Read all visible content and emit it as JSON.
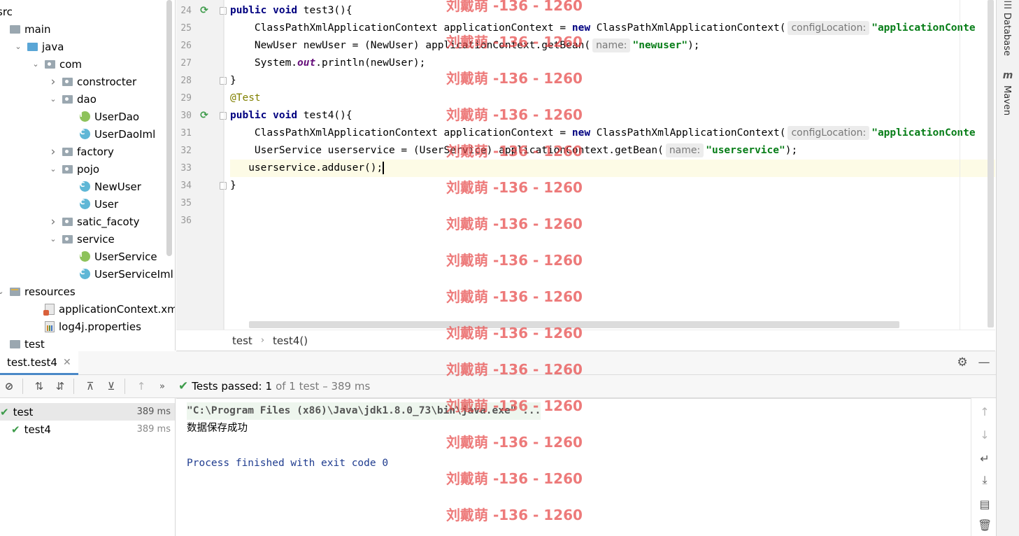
{
  "project_tree": [
    {
      "label": "src",
      "icon": "folder-icon",
      "indent": 0,
      "arrow": ""
    },
    {
      "label": "main",
      "icon": "folder-icon",
      "indent": 0,
      "arrow": ""
    },
    {
      "label": "java",
      "icon": "source-folder-icon",
      "indent": 1,
      "arrow": "down"
    },
    {
      "label": "com",
      "icon": "package-icon",
      "indent": 2,
      "arrow": "down"
    },
    {
      "label": "constrocter",
      "icon": "package-icon",
      "indent": 3,
      "arrow": "right"
    },
    {
      "label": "dao",
      "icon": "package-icon",
      "indent": 3,
      "arrow": "down"
    },
    {
      "label": "UserDao",
      "icon": "interface-icon",
      "indent": 4,
      "arrow": ""
    },
    {
      "label": "UserDaoIml",
      "icon": "class-icon",
      "indent": 4,
      "arrow": ""
    },
    {
      "label": "factory",
      "icon": "package-icon",
      "indent": 3,
      "arrow": "right"
    },
    {
      "label": "pojo",
      "icon": "package-icon",
      "indent": 3,
      "arrow": "down"
    },
    {
      "label": "NewUser",
      "icon": "class-icon",
      "indent": 4,
      "arrow": ""
    },
    {
      "label": "User",
      "icon": "class-icon",
      "indent": 4,
      "arrow": ""
    },
    {
      "label": "satic_facoty",
      "icon": "package-icon",
      "indent": 3,
      "arrow": "right"
    },
    {
      "label": "service",
      "icon": "package-icon",
      "indent": 3,
      "arrow": "down"
    },
    {
      "label": "UserService",
      "icon": "interface-icon",
      "indent": 4,
      "arrow": ""
    },
    {
      "label": "UserServiceIml",
      "icon": "class-icon",
      "indent": 4,
      "arrow": ""
    },
    {
      "label": "resources",
      "icon": "resources-folder-icon",
      "indent": 0,
      "arrow": "down"
    },
    {
      "label": "applicationContext.xml",
      "icon": "xml-file-icon",
      "indent": 2,
      "arrow": ""
    },
    {
      "label": "log4j.properties",
      "icon": "properties-file-icon",
      "indent": 2,
      "arrow": ""
    },
    {
      "label": "test",
      "icon": "folder-icon",
      "indent": 0,
      "arrow": ""
    }
  ],
  "editor": {
    "line_numbers": [
      "24",
      "25",
      "26",
      "27",
      "28",
      "29",
      "30",
      "31",
      "32",
      "33",
      "34",
      "35",
      "36"
    ],
    "current_line_index": 9,
    "hints": {
      "config_location": "configLocation:",
      "name": "name:"
    },
    "tokens": {
      "public": "public",
      "void": "void",
      "new": "new",
      "test3_sig": " test3(){",
      "test4_sig": " test4(){",
      "line25_a": "    ClassPathXmlApplicationContext applicationContext = ",
      "line25_b": " ClassPathXmlApplicationContext(",
      "app_ctx_str": "\"applicationConte",
      "line26_a": "    NewUser newUser = (NewUser) applicationContext.getBean(",
      "newuser_str": "\"newuser\"",
      "line26_end": ");",
      "line27_a": "    System.",
      "out": "out",
      "line27_b": ".println(newUser);",
      "close_brace": "}",
      "annotation": "@Test",
      "line32_a": "    UserService userservice = (UserService) applicationContext.getBean(",
      "userservice_str": "\"userservice\"",
      "line33": "   userservice.adduser();"
    }
  },
  "breadcrumb": [
    "test",
    "test4()"
  ],
  "right_tools": [
    "Database",
    "Maven"
  ],
  "run_panel": {
    "tab_label": "test.test4",
    "status_label": "Tests passed:",
    "passed_count": "1",
    "status_detail": "of 1 test – 389 ms",
    "test_tree": [
      {
        "name": "test",
        "duration": "389 ms"
      },
      {
        "name": "test4",
        "duration": "389 ms"
      }
    ],
    "console": {
      "command": "\"C:\\Program Files (x86)\\Java\\jdk1.8.0_73\\bin\\java.exe\" ...",
      "output": "数据保存成功",
      "exit": "Process finished with exit code 0"
    }
  },
  "watermark_text": "刘戴萌 -136 - 1260",
  "colors": {
    "keyword": "#000080",
    "string": "#067d17",
    "annotation": "#808000",
    "pass_green": "#3d9b4a",
    "watermark": "#e64646"
  }
}
